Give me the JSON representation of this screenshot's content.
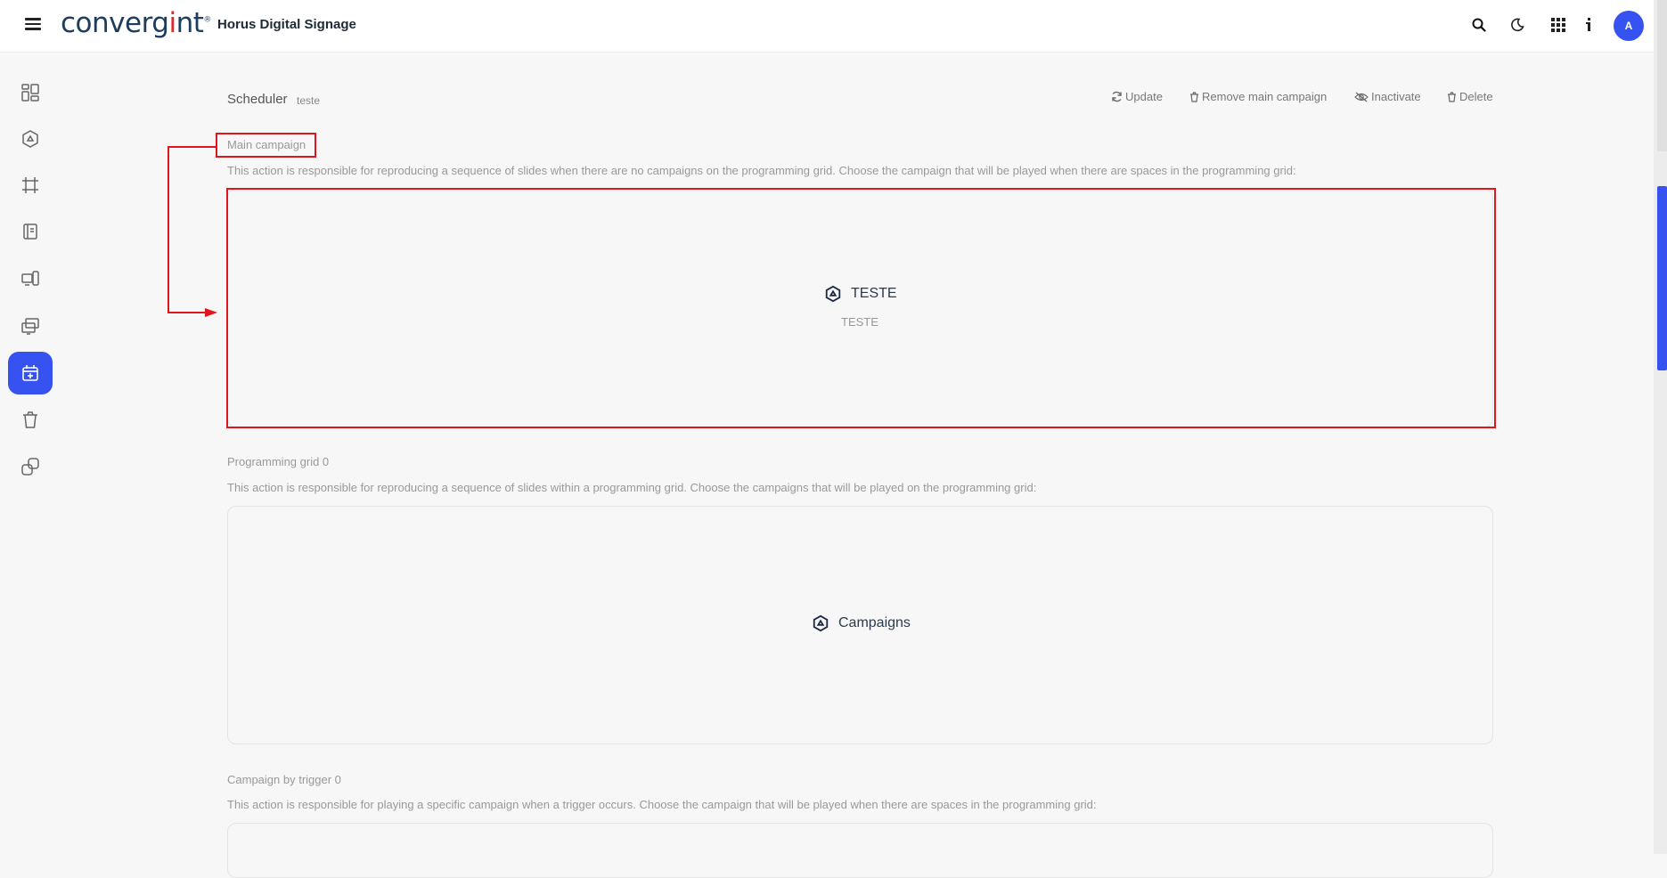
{
  "header": {
    "logo_text": "convergint",
    "app_title": "Horus Digital Signage",
    "avatar_initial": "A",
    "icons": [
      "menu-icon",
      "search-icon",
      "moon-icon",
      "apps-grid-icon",
      "info-icon"
    ]
  },
  "sidebar": {
    "items": [
      {
        "name": "dashboard",
        "icon": "dashboard-icon",
        "active": false
      },
      {
        "name": "campaigns",
        "icon": "campaign-icon",
        "active": false
      },
      {
        "name": "layouts",
        "icon": "frame-icon",
        "active": false
      },
      {
        "name": "content",
        "icon": "document-icon",
        "active": false
      },
      {
        "name": "devices",
        "icon": "devices-icon",
        "active": false
      },
      {
        "name": "screens",
        "icon": "screens-icon",
        "active": false
      },
      {
        "name": "scheduler",
        "icon": "calendar-plus-icon",
        "active": true
      },
      {
        "name": "trash",
        "icon": "trash-icon",
        "active": false
      },
      {
        "name": "integrations",
        "icon": "link-icon",
        "active": false
      }
    ]
  },
  "page": {
    "title": "Scheduler",
    "subtitle": "teste",
    "actions": {
      "update": "Update",
      "remove_main": "Remove main campaign",
      "inactivate": "Inactivate",
      "delete": "Delete"
    }
  },
  "sections": {
    "main": {
      "label": "Main campaign",
      "desc": "This action is responsible for reproducing a sequence of slides when there are no campaigns on the programming grid. Choose the campaign that will be played when there are spaces in the programming grid:",
      "campaign_name": "TESTE",
      "campaign_sub": "TESTE"
    },
    "grid": {
      "label": "Programming grid 0",
      "desc": "This action is responsible for reproducing a sequence of slides within a programming grid. Choose the campaigns that will be played on the programming grid:",
      "placeholder": "Campaigns"
    },
    "trigger": {
      "label": "Campaign by trigger 0",
      "desc": "This action is responsible for playing a specific campaign when a trigger occurs. Choose the campaign that will be played when there are spaces in the programming grid:"
    }
  },
  "colors": {
    "accent": "#3652f0",
    "annotation": "#e0161f",
    "brand_navy": "#1e3d5c",
    "brand_red": "#e1262d"
  }
}
